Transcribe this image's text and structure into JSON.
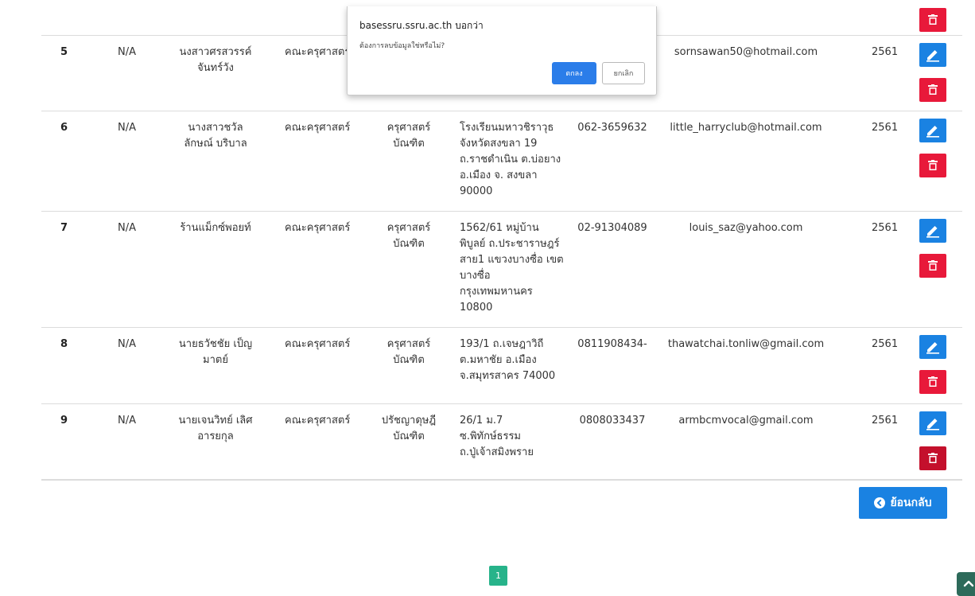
{
  "table": {
    "rows": [
      {
        "no": "5",
        "id": "N/A",
        "name": "นงสาวศรสวรรค์ จันทร์วัง",
        "faculty": "คณะครุศาสตร์",
        "degree": "",
        "address": "",
        "phone": "",
        "email": "sornsawan50@hotmail.com",
        "year": "2561"
      },
      {
        "no": "6",
        "id": "N/A",
        "name": "นางสาวชวัล ลักษณ์ บริบาล",
        "faculty": "คณะครุศาสตร์",
        "degree": "ครุศาสตร์ บัณฑิต",
        "address": "โรงเรียนมหาวชิราวุธ จังหวัดสงขลา 19 ถ.ราชดำเนิน ต.บ่อยาง อ.เมือง จ. สงขลา 90000",
        "phone": "062-3659632",
        "email": "little_harryclub@hotmail.com",
        "year": "2561"
      },
      {
        "no": "7",
        "id": "N/A",
        "name": "ร้านแม็กซ์พอยท์",
        "faculty": "คณะครุศาสตร์",
        "degree": "ครุศาสตร์ บัณฑิต",
        "address": "1562/61 หมู่บ้านพิบูลย์ ถ.ประชาราษฎร์ สาย1 แขวงบางซื่อ เขต บางซื่อ กรุงเทพมหานคร 10800",
        "phone": "02-91304089",
        "email": "louis_saz@yahoo.com",
        "year": "2561"
      },
      {
        "no": "8",
        "id": "N/A",
        "name": "นายธวัชชัย เป็ญ มาตย์",
        "faculty": "คณะครุศาสตร์",
        "degree": "ครุศาสตร์ บัณฑิต",
        "address": "193/1 ถ.เจษฎาวิถี ต.มหาชัย อ.เมือง จ.สมุทรสาคร 74000",
        "phone": "0811908434-",
        "email": "thawatchai.tonliw@gmail.com",
        "year": "2561"
      },
      {
        "no": "9",
        "id": "N/A",
        "name": "นายเจนวิทย์ เลิศ อารยกุล",
        "faculty": "คณะครุศาสตร์",
        "degree": "ปรัชญาดุษฎี บัณฑิต",
        "address": "26/1 ม.7 ซ.พิทักษ์ธรรม ถ.ปู่เจ้าสมิงพราย",
        "phone": "0808033437",
        "email": "armbcmvocal@gmail.com",
        "year": "2561"
      }
    ]
  },
  "back_button": {
    "label": "ย้อนกลับ"
  },
  "pagination": {
    "current": "1"
  },
  "dialog": {
    "title": "basessru.ssru.ac.th บอกว่า",
    "message": "ต้องการลบข้อมูลใช่หรือไม่?",
    "ok_label": "ตกลง",
    "cancel_label": "ยกเลิก"
  },
  "colors": {
    "edit": "#1a82e2",
    "delete": "#e8193a",
    "back": "#1a82e2",
    "page": "#27b38a"
  },
  "icons": {
    "edit": "pencil-icon",
    "delete": "trash-icon",
    "back": "chevron-circle-left-icon",
    "scroll": "chevron-up-icon"
  }
}
